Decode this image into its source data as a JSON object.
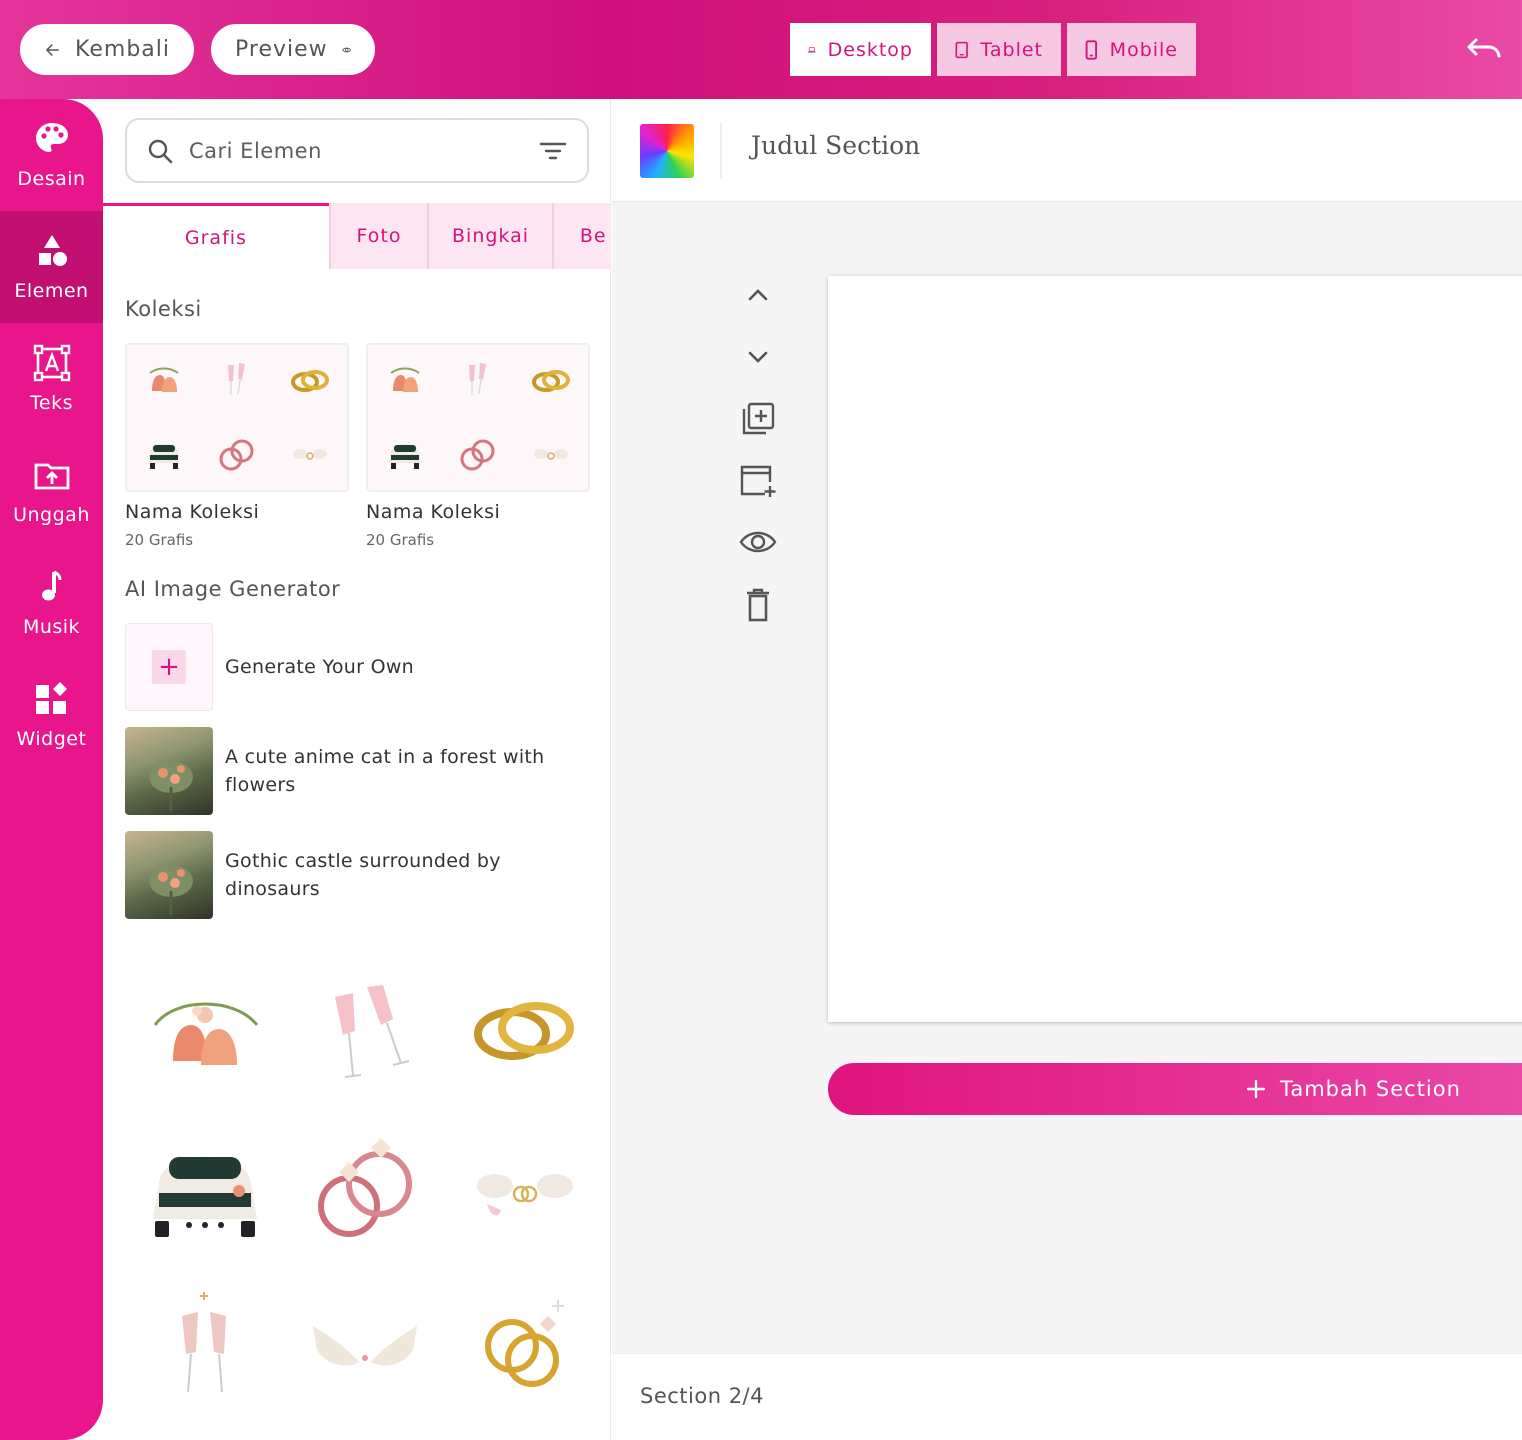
{
  "topbar": {
    "back_label": "Kembali",
    "preview_label": "Preview",
    "devices": [
      {
        "label": "Desktop",
        "active": true
      },
      {
        "label": "Tablet",
        "active": false
      },
      {
        "label": "Mobile",
        "active": false
      }
    ]
  },
  "rail": {
    "items": [
      {
        "label": "Desain",
        "icon": "palette-icon"
      },
      {
        "label": "Elemen",
        "icon": "shapes-icon",
        "active": true
      },
      {
        "label": "Teks",
        "icon": "text-box-icon"
      },
      {
        "label": "Unggah",
        "icon": "folder-upload-icon"
      },
      {
        "label": "Musik",
        "icon": "music-note-icon"
      },
      {
        "label": "Widget",
        "icon": "widget-icon"
      }
    ]
  },
  "panel": {
    "search_placeholder": "Cari Elemen",
    "tabs": [
      "Grafis",
      "Foto",
      "Bingkai",
      "Be"
    ],
    "collections_title": "Koleksi",
    "collections": [
      {
        "name": "Nama Koleksi",
        "count": "20 Grafis"
      },
      {
        "name": "Nama Koleksi",
        "count": "20 Grafis"
      }
    ],
    "ai_title": "AI Image Generator",
    "ai_items": [
      {
        "text": "Generate Your Own"
      },
      {
        "text": "A cute anime cat in a forest with flowers"
      },
      {
        "text": "Gothic castle surrounded by dinosaurs"
      }
    ],
    "graphics": [
      "wedding-bells",
      "champagne-glasses",
      "gold-rings",
      "wedding-car",
      "pink-rings",
      "doves-rings",
      "champagne-toast",
      "doves",
      "gold-ring-diamond"
    ]
  },
  "editor": {
    "section_title": "Judul Section",
    "add_section_label": "Tambah Section",
    "footer_label": "Section 2/4"
  },
  "colors": {
    "accent": "#e8168a",
    "accent_dark": "#c20f72",
    "tab_bg": "#fde6f2"
  }
}
